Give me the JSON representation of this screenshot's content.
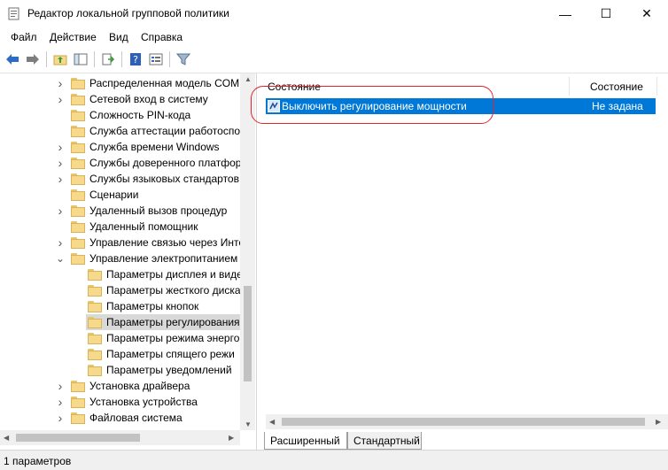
{
  "window": {
    "title": "Редактор локальной групповой политики",
    "minimize": "—",
    "maximize": "☐",
    "close": "✕"
  },
  "menu": [
    "Файл",
    "Действие",
    "Вид",
    "Справка"
  ],
  "tree": {
    "items": [
      {
        "label": "Распределенная модель COM",
        "level": 1,
        "chevron": "›"
      },
      {
        "label": "Сетевой вход в систему",
        "level": 1,
        "chevron": "›"
      },
      {
        "label": "Сложность PIN-кода",
        "level": 1,
        "chevron": ""
      },
      {
        "label": "Служба аттестации работоспо",
        "level": 1,
        "chevron": ""
      },
      {
        "label": "Служба времени Windows",
        "level": 1,
        "chevron": "›"
      },
      {
        "label": "Службы доверенного платфор",
        "level": 1,
        "chevron": "›"
      },
      {
        "label": "Службы языковых стандартов",
        "level": 1,
        "chevron": "›"
      },
      {
        "label": "Сценарии",
        "level": 1,
        "chevron": ""
      },
      {
        "label": "Удаленный вызов процедур",
        "level": 1,
        "chevron": "›"
      },
      {
        "label": "Удаленный помощник",
        "level": 1,
        "chevron": ""
      },
      {
        "label": "Управление связью через Инте",
        "level": 1,
        "chevron": "›"
      },
      {
        "label": "Управление электропитанием",
        "level": 1,
        "chevron": "⌄"
      },
      {
        "label": "Параметры дисплея и виде",
        "level": 2,
        "chevron": ""
      },
      {
        "label": "Параметры жесткого диска",
        "level": 2,
        "chevron": ""
      },
      {
        "label": "Параметры кнопок",
        "level": 2,
        "chevron": ""
      },
      {
        "label": "Параметры регулирования",
        "level": 2,
        "chevron": "",
        "selected": true
      },
      {
        "label": "Параметры режима энерго",
        "level": 2,
        "chevron": ""
      },
      {
        "label": "Параметры спящего режи",
        "level": 2,
        "chevron": ""
      },
      {
        "label": "Параметры уведомлений",
        "level": 2,
        "chevron": ""
      },
      {
        "label": "Установка драйвера",
        "level": 1,
        "chevron": "›"
      },
      {
        "label": "Установка устройства",
        "level": 1,
        "chevron": "›"
      },
      {
        "label": "Файловая система",
        "level": 1,
        "chevron": "›"
      }
    ]
  },
  "list": {
    "columns": [
      "Состояние",
      "Состояние"
    ],
    "rows": [
      {
        "name": "Выключить регулирование мощности",
        "state": "Не задана"
      }
    ]
  },
  "tabs": [
    "Расширенный",
    "Стандартный"
  ],
  "status": "1 параметров",
  "colors": {
    "selection": "#0078d7",
    "highlight_circle": "#e0242c"
  }
}
